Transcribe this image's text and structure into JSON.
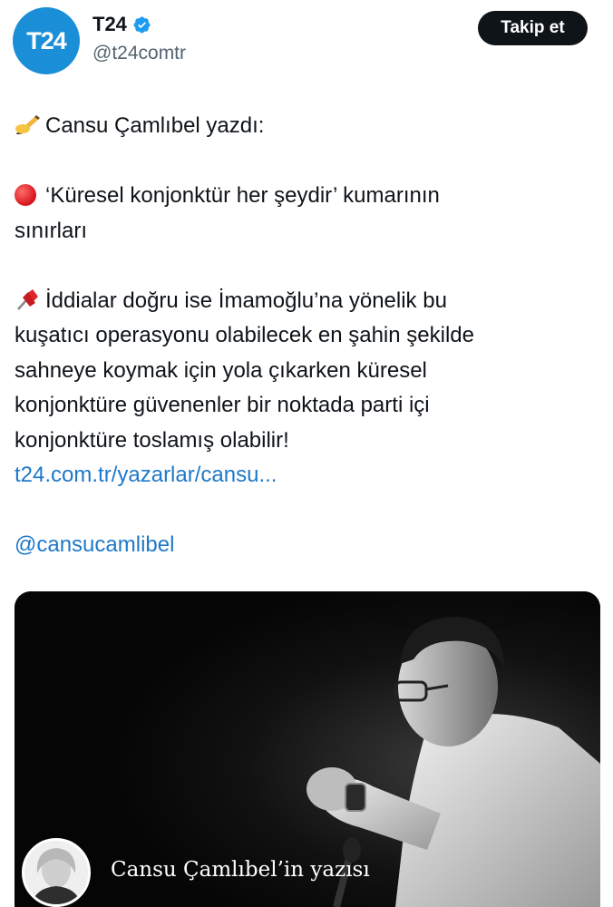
{
  "account": {
    "display_name": "T24",
    "handle": "@t24comtr",
    "avatar_text": "T24",
    "verified": true,
    "avatar_color": "#1a8fd8"
  },
  "follow_button": {
    "label": "Takip et"
  },
  "tweet": {
    "line_author": "Cansu Çamlıbel yazdı:",
    "headline_line1": "‘Küresel konjonktür her şeydir’ kumarının",
    "headline_line2": "sınırları",
    "body_lines": [
      "İddialar doğru ise İmamoğlu’na yönelik bu",
      "kuşatıcı operasyonu olabilecek en şahin şekilde",
      "sahneye koymak için yola çıkarken küresel",
      "konjonktüre güvenenler bir noktada parti içi",
      "konjonktüre toslamış olabilir!"
    ],
    "link_text": "t24.com.tr/yazarlar/cansu...",
    "mention": "@cansucamlibel"
  },
  "media": {
    "caption": "Cansu Çamlıbel’in yazısı"
  },
  "icons": {
    "author_emoji": "writing-hand-icon",
    "headline_emoji": "red-circle-icon",
    "body_emoji": "pushpin-icon",
    "verified_badge": "verified-badge-icon"
  },
  "colors": {
    "link": "#1d79c9",
    "follow_button_bg": "#0f1419",
    "handle": "#536471"
  }
}
